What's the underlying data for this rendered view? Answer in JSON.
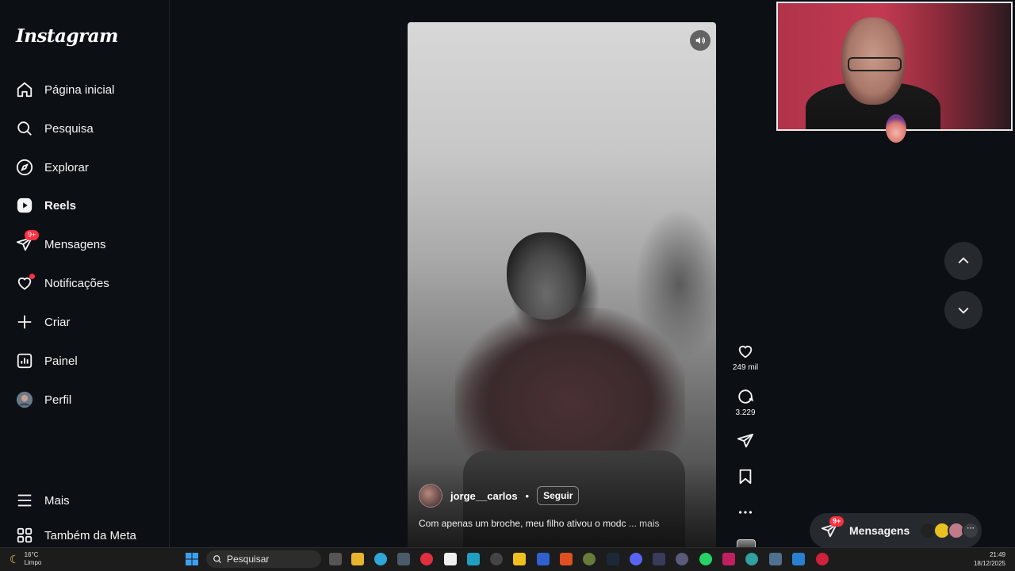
{
  "sidebar": {
    "logo": "Instagram",
    "items": [
      {
        "label": "Página inicial",
        "icon": "home-icon"
      },
      {
        "label": "Pesquisa",
        "icon": "search-icon"
      },
      {
        "label": "Explorar",
        "icon": "compass-icon"
      },
      {
        "label": "Reels",
        "icon": "reels-icon",
        "active": true
      },
      {
        "label": "Mensagens",
        "icon": "messenger-icon",
        "badge": "9+"
      },
      {
        "label": "Notificações",
        "icon": "heart-icon"
      },
      {
        "label": "Criar",
        "icon": "plus-icon"
      },
      {
        "label": "Painel",
        "icon": "dashboard-icon"
      },
      {
        "label": "Perfil",
        "icon": "profile-avatar"
      }
    ],
    "more": "Mais",
    "also_meta": "Também da Meta"
  },
  "reel": {
    "author": "jorge__carlos",
    "separator": "•",
    "follow": "Seguir",
    "caption": "Com apenas um broche, meu filho ativou o modc",
    "more": "... mais"
  },
  "actions": {
    "likes": "249 mil",
    "comments": "3.229"
  },
  "messages_pill": {
    "label": "Mensagens",
    "badge": "9+"
  },
  "taskbar": {
    "temperature": "16°C",
    "condition": "Limpo",
    "search_placeholder": "Pesquisar",
    "time": "21:49",
    "date": "18/12/2025"
  },
  "colors": {
    "background": "#0c1014",
    "badge": "#ff3040",
    "pill": "#262a2e"
  }
}
